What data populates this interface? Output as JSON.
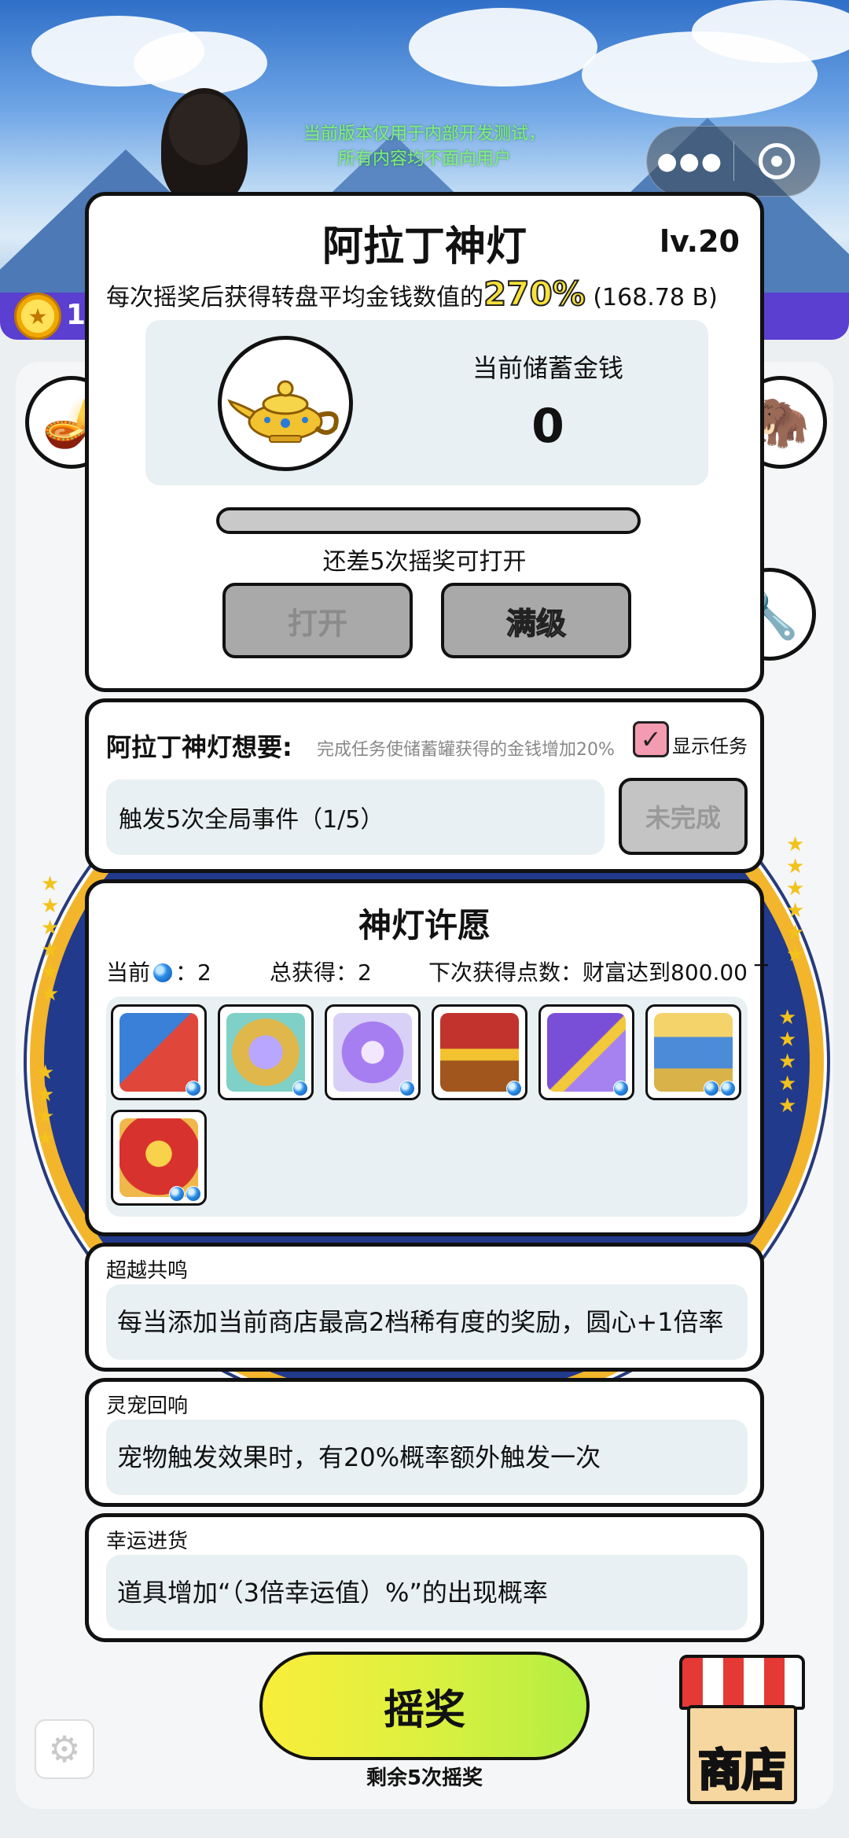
{
  "notice": {
    "line1": "当前版本仅用于内部开发测试，",
    "line2": "所有内容均不面向用户"
  },
  "capsule": {
    "more_icon": "more-dots-icon",
    "close_icon": "mini-program-close-icon"
  },
  "header": {
    "coin_count": "1"
  },
  "lamp_panel": {
    "title": "阿拉丁神灯",
    "level": "lv.20",
    "desc_prefix": "每次摇奖后获得转盘平均金钱数值的",
    "desc_percent": "270%",
    "desc_suffix": "(168.78 B)",
    "savings_label": "当前储蓄金钱",
    "savings_value": "0",
    "progress": 0,
    "remaining_text": "还差5次摇奖可打开",
    "open_label": "打开",
    "max_label": "满级"
  },
  "want_panel": {
    "heading": "阿拉丁神灯想要:",
    "note": "完成任务使储蓄罐获得的金钱增加20%",
    "show_tasks_label": "显示任务",
    "show_tasks_checked": true,
    "task_text": "触发5次全局事件（1/5）",
    "status_label": "未完成"
  },
  "wish_panel": {
    "title": "神灯许愿",
    "current_label": "当前",
    "current_value": "：2",
    "total_label": "总获得：2",
    "next_label": "下次获得点数：财富达到800.00 T",
    "items": [
      {
        "name": "toolbox-item",
        "cost": 1
      },
      {
        "name": "gem-altar-item",
        "cost": 1
      },
      {
        "name": "crystal-orb-item",
        "cost": 1
      },
      {
        "name": "treasure-chest-item",
        "cost": 1
      },
      {
        "name": "gift-box-item",
        "cost": 1
      },
      {
        "name": "golden-gate-item",
        "cost": 2
      },
      {
        "name": "star-stage-item",
        "cost": 2
      }
    ]
  },
  "effects": [
    {
      "title": "超越共鸣",
      "body": "每当添加当前商店最高2档稀有度的奖励，圆心+1倍率"
    },
    {
      "title": "灵宠回响",
      "body": "宠物触发效果时，有20%概率额外触发一次"
    },
    {
      "title": "幸运进货",
      "body": "道具增加“（3倍幸运值）%”的出现概率"
    }
  ],
  "bottom": {
    "spin_label": "摇奖",
    "spin_remaining": "剩余5次摇奖",
    "shop_label": "商店",
    "settings_icon": "gear-icon"
  }
}
